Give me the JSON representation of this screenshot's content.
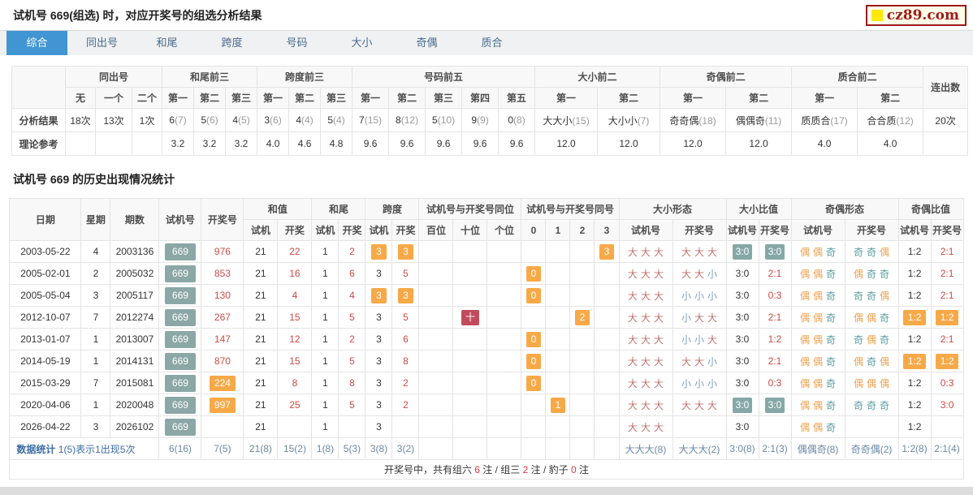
{
  "page_title": "试机号 669(组选) 时，对应开奖号的组选分析结果",
  "logo": {
    "text": "cz89.com"
  },
  "tabs": [
    {
      "label": "综合",
      "active": true
    },
    {
      "label": "同出号"
    },
    {
      "label": "和尾"
    },
    {
      "label": "跨度"
    },
    {
      "label": "号码"
    },
    {
      "label": "大小"
    },
    {
      "label": "奇偶"
    },
    {
      "label": "质合"
    }
  ],
  "analysis": {
    "groups": [
      {
        "label": "同出号",
        "cols": [
          "无",
          "一个",
          "二个"
        ]
      },
      {
        "label": "和尾前三",
        "cols": [
          "第一",
          "第二",
          "第三"
        ]
      },
      {
        "label": "跨度前三",
        "cols": [
          "第一",
          "第二",
          "第三"
        ]
      },
      {
        "label": "号码前五",
        "cols": [
          "第一",
          "第二",
          "第三",
          "第四",
          "第五"
        ]
      },
      {
        "label": "大小前二",
        "cols": [
          "第一",
          "第二"
        ]
      },
      {
        "label": "奇偶前二",
        "cols": [
          "第一",
          "第二"
        ]
      },
      {
        "label": "质合前二",
        "cols": [
          "第一",
          "第二"
        ]
      }
    ],
    "last_col": "连出数",
    "rows": [
      {
        "label": "分析结果",
        "values": [
          "18次",
          "13次",
          "1次",
          "6(7)",
          "5(6)",
          "4(5)",
          "3(6)",
          "4(4)",
          "5(4)",
          "7(15)",
          "8(12)",
          "5(10)",
          "9(9)",
          "0(8)",
          "大大小(15)",
          "大小小(7)",
          "奇奇偶(18)",
          "偶偶奇(11)",
          "质质合(17)",
          "合合质(12)",
          "20次"
        ]
      },
      {
        "label": "理论参考",
        "values": [
          "",
          "",
          "",
          "3.2",
          "3.2",
          "3.2",
          "4.0",
          "4.6",
          "4.8",
          "9.6",
          "9.6",
          "9.6",
          "9.6",
          "9.6",
          "12.0",
          "12.0",
          "12.0",
          "12.0",
          "4.0",
          "4.0",
          ""
        ]
      }
    ]
  },
  "history": {
    "title": "试机号 669 的历史出现情况统计",
    "header": {
      "simple": [
        "日期",
        "星期",
        "期数",
        "试机号",
        "开奖号"
      ],
      "groups": [
        {
          "label": "和值",
          "cols": [
            "试机",
            "开奖"
          ]
        },
        {
          "label": "和尾",
          "cols": [
            "试机",
            "开奖"
          ]
        },
        {
          "label": "跨度",
          "cols": [
            "试机",
            "开奖"
          ]
        },
        {
          "label": "试机号与开奖号同位",
          "cols": [
            "百位",
            "十位",
            "个位"
          ]
        },
        {
          "label": "试机号与开奖号同号",
          "cols": [
            "0",
            "1",
            "2",
            "3"
          ]
        },
        {
          "label": "大小形态",
          "cols": [
            "试机号",
            "开奖号"
          ]
        },
        {
          "label": "大小比值",
          "cols": [
            "试机号",
            "开奖号"
          ]
        },
        {
          "label": "奇偶形态",
          "cols": [
            "试机号",
            "开奖号"
          ]
        },
        {
          "label": "奇偶比值",
          "cols": [
            "试机号",
            "开奖号"
          ]
        }
      ]
    },
    "rows": [
      [
        [
          "2003-05-22",
          ""
        ],
        [
          "4",
          ""
        ],
        [
          "2003136",
          ""
        ],
        [
          "669",
          "b669"
        ],
        [
          "976",
          "red"
        ],
        [
          "21",
          ""
        ],
        [
          "22",
          "red"
        ],
        [
          "1",
          ""
        ],
        [
          "2",
          "red"
        ],
        [
          "3",
          "bo"
        ],
        [
          "3",
          "bo"
        ],
        [
          "",
          ""
        ],
        [
          "",
          ""
        ],
        [
          "",
          ""
        ],
        [
          "",
          ""
        ],
        [
          "",
          ""
        ],
        [
          "",
          ""
        ],
        [
          "3",
          "bo"
        ],
        [
          "大大大",
          "pat"
        ],
        [
          "大大大",
          "pat"
        ],
        [
          "3:0",
          "bt"
        ],
        [
          "3:0",
          "bt"
        ],
        [
          "偶偶奇",
          "pat"
        ],
        [
          "奇奇偶",
          "pat"
        ],
        [
          "1:2",
          ""
        ],
        [
          "2:1",
          "red"
        ]
      ],
      [
        [
          "2005-02-01",
          ""
        ],
        [
          "2",
          ""
        ],
        [
          "2005032",
          ""
        ],
        [
          "669",
          "b669"
        ],
        [
          "853",
          "red"
        ],
        [
          "21",
          ""
        ],
        [
          "16",
          "red"
        ],
        [
          "1",
          ""
        ],
        [
          "6",
          "red"
        ],
        [
          "3",
          ""
        ],
        [
          "5",
          "red"
        ],
        [
          "",
          ""
        ],
        [
          "",
          ""
        ],
        [
          "",
          ""
        ],
        [
          "0",
          "bo"
        ],
        [
          "",
          ""
        ],
        [
          "",
          ""
        ],
        [
          "",
          ""
        ],
        [
          "大大大",
          "pat"
        ],
        [
          "大大小",
          "pat"
        ],
        [
          "3:0",
          ""
        ],
        [
          "2:1",
          "red"
        ],
        [
          "偶偶奇",
          "pat"
        ],
        [
          "偶奇奇",
          "pat"
        ],
        [
          "1:2",
          ""
        ],
        [
          "2:1",
          "red"
        ]
      ],
      [
        [
          "2005-05-04",
          ""
        ],
        [
          "3",
          ""
        ],
        [
          "2005117",
          ""
        ],
        [
          "669",
          "b669"
        ],
        [
          "130",
          "red"
        ],
        [
          "21",
          ""
        ],
        [
          "4",
          "red"
        ],
        [
          "1",
          ""
        ],
        [
          "4",
          "red"
        ],
        [
          "3",
          "bo"
        ],
        [
          "3",
          "bo"
        ],
        [
          "",
          ""
        ],
        [
          "",
          ""
        ],
        [
          "",
          ""
        ],
        [
          "0",
          "bo"
        ],
        [
          "",
          ""
        ],
        [
          "",
          ""
        ],
        [
          "",
          ""
        ],
        [
          "大大大",
          "pat"
        ],
        [
          "小小小",
          "pat"
        ],
        [
          "3:0",
          ""
        ],
        [
          "0:3",
          "red"
        ],
        [
          "偶偶奇",
          "pat"
        ],
        [
          "奇奇偶",
          "pat"
        ],
        [
          "1:2",
          ""
        ],
        [
          "2:1",
          "red"
        ]
      ],
      [
        [
          "2012-10-07",
          ""
        ],
        [
          "7",
          ""
        ],
        [
          "2012274",
          ""
        ],
        [
          "669",
          "b669"
        ],
        [
          "267",
          "red"
        ],
        [
          "21",
          ""
        ],
        [
          "15",
          "red"
        ],
        [
          "1",
          ""
        ],
        [
          "5",
          "red"
        ],
        [
          "3",
          ""
        ],
        [
          "5",
          "red"
        ],
        [
          "",
          ""
        ],
        [
          "十",
          "bc"
        ],
        [
          "",
          ""
        ],
        [
          "",
          ""
        ],
        [
          "",
          ""
        ],
        [
          "2",
          "bo"
        ],
        [
          "",
          ""
        ],
        [
          "大大大",
          "pat"
        ],
        [
          "小大大",
          "pat"
        ],
        [
          "3:0",
          ""
        ],
        [
          "2:1",
          "red"
        ],
        [
          "偶偶奇",
          "pat"
        ],
        [
          "偶偶奇",
          "pat"
        ],
        [
          "1:2",
          "bo"
        ],
        [
          "1:2",
          "bo"
        ]
      ],
      [
        [
          "2013-01-07",
          ""
        ],
        [
          "1",
          ""
        ],
        [
          "2013007",
          ""
        ],
        [
          "669",
          "b669"
        ],
        [
          "147",
          "red"
        ],
        [
          "21",
          ""
        ],
        [
          "12",
          "red"
        ],
        [
          "1",
          ""
        ],
        [
          "2",
          "red"
        ],
        [
          "3",
          ""
        ],
        [
          "6",
          "red"
        ],
        [
          "",
          ""
        ],
        [
          "",
          ""
        ],
        [
          "",
          ""
        ],
        [
          "0",
          "bo"
        ],
        [
          "",
          ""
        ],
        [
          "",
          ""
        ],
        [
          "",
          ""
        ],
        [
          "大大大",
          "pat"
        ],
        [
          "小小大",
          "pat"
        ],
        [
          "3:0",
          ""
        ],
        [
          "1:2",
          "red"
        ],
        [
          "偶偶奇",
          "pat"
        ],
        [
          "奇偶奇",
          "pat"
        ],
        [
          "1:2",
          ""
        ],
        [
          "2:1",
          "red"
        ]
      ],
      [
        [
          "2014-05-19",
          ""
        ],
        [
          "1",
          ""
        ],
        [
          "2014131",
          ""
        ],
        [
          "669",
          "b669"
        ],
        [
          "870",
          "red"
        ],
        [
          "21",
          ""
        ],
        [
          "15",
          "red"
        ],
        [
          "1",
          ""
        ],
        [
          "5",
          "red"
        ],
        [
          "3",
          ""
        ],
        [
          "8",
          "red"
        ],
        [
          "",
          ""
        ],
        [
          "",
          ""
        ],
        [
          "",
          ""
        ],
        [
          "0",
          "bo"
        ],
        [
          "",
          ""
        ],
        [
          "",
          ""
        ],
        [
          "",
          ""
        ],
        [
          "大大大",
          "pat"
        ],
        [
          "大大小",
          "pat"
        ],
        [
          "3:0",
          ""
        ],
        [
          "2:1",
          "red"
        ],
        [
          "偶偶奇",
          "pat"
        ],
        [
          "偶奇偶",
          "pat"
        ],
        [
          "1:2",
          "bo"
        ],
        [
          "1:2",
          "bo"
        ]
      ],
      [
        [
          "2015-03-29",
          ""
        ],
        [
          "7",
          ""
        ],
        [
          "2015081",
          ""
        ],
        [
          "669",
          "b669"
        ],
        [
          "224",
          "bo"
        ],
        [
          "21",
          ""
        ],
        [
          "8",
          "red"
        ],
        [
          "1",
          ""
        ],
        [
          "8",
          "red"
        ],
        [
          "3",
          ""
        ],
        [
          "2",
          "red"
        ],
        [
          "",
          ""
        ],
        [
          "",
          ""
        ],
        [
          "",
          ""
        ],
        [
          "0",
          "bo"
        ],
        [
          "",
          ""
        ],
        [
          "",
          ""
        ],
        [
          "",
          ""
        ],
        [
          "大大大",
          "pat"
        ],
        [
          "小小小",
          "pat"
        ],
        [
          "3:0",
          ""
        ],
        [
          "0:3",
          "red"
        ],
        [
          "偶偶奇",
          "pat"
        ],
        [
          "偶偶偶",
          "pat"
        ],
        [
          "1:2",
          ""
        ],
        [
          "0:3",
          "red"
        ]
      ],
      [
        [
          "2020-04-06",
          ""
        ],
        [
          "1",
          ""
        ],
        [
          "2020048",
          ""
        ],
        [
          "669",
          "b669"
        ],
        [
          "997",
          "bo"
        ],
        [
          "21",
          ""
        ],
        [
          "25",
          "red"
        ],
        [
          "1",
          ""
        ],
        [
          "5",
          "red"
        ],
        [
          "3",
          ""
        ],
        [
          "2",
          "red"
        ],
        [
          "",
          ""
        ],
        [
          "",
          ""
        ],
        [
          "",
          ""
        ],
        [
          "",
          ""
        ],
        [
          "1",
          "bo"
        ],
        [
          "",
          ""
        ],
        [
          "",
          ""
        ],
        [
          "大大大",
          "pat"
        ],
        [
          "大大大",
          "pat"
        ],
        [
          "3:0",
          "bt"
        ],
        [
          "3:0",
          "bt"
        ],
        [
          "偶偶奇",
          "pat"
        ],
        [
          "奇奇奇",
          "pat"
        ],
        [
          "1:2",
          ""
        ],
        [
          "3:0",
          "red"
        ]
      ],
      [
        [
          "2026-04-22",
          ""
        ],
        [
          "3",
          ""
        ],
        [
          "2026102",
          ""
        ],
        [
          "669",
          "b669"
        ],
        [
          "",
          ""
        ],
        [
          "21",
          ""
        ],
        [
          "",
          ""
        ],
        [
          "1",
          ""
        ],
        [
          "",
          ""
        ],
        [
          "3",
          ""
        ],
        [
          "",
          ""
        ],
        [
          "",
          ""
        ],
        [
          "",
          ""
        ],
        [
          "",
          ""
        ],
        [
          "",
          ""
        ],
        [
          "",
          ""
        ],
        [
          "",
          ""
        ],
        [
          "",
          ""
        ],
        [
          "大大大",
          "pat"
        ],
        [
          "",
          ""
        ],
        [
          "3:0",
          ""
        ],
        [
          "",
          ""
        ],
        [
          "偶偶奇",
          "pat"
        ],
        [
          "",
          ""
        ],
        [
          "1:2",
          ""
        ],
        [
          "",
          ""
        ]
      ]
    ],
    "stats": {
      "label": "数据统计",
      "note": "1(5)表示1出现5次",
      "values": [
        "6(16)",
        "7(5)",
        "21(8)",
        "15(2)",
        "1(8)",
        "5(3)",
        "3(8)",
        "3(2)",
        "",
        "",
        "",
        "",
        "",
        "",
        "",
        "大大大(8)",
        "大大大(2)",
        "3:0(8)",
        "2:1(3)",
        "偶偶奇(8)",
        "奇奇偶(2)",
        "1:2(8)",
        "2:1(4)"
      ]
    },
    "footer_segments": [
      {
        "text": "开奖号中，共有组六 "
      },
      {
        "text": "6",
        "red": true
      },
      {
        "text": " 注 / 组三 "
      },
      {
        "text": "2",
        "red": true
      },
      {
        "text": " 注 / 豹子 "
      },
      {
        "text": "0",
        "red": true
      },
      {
        "text": " 注"
      }
    ]
  },
  "colors": {
    "accent_blue": "#4195d3",
    "red_value": "#cf4a45",
    "orange_badge": "#f7a948",
    "teal_badge": "#85a8a6",
    "crimson_badge": "#c14b5d",
    "trial_badge": "#8ba7a6",
    "big_char": "#c0716f",
    "small_char": "#7e9fc5",
    "even_char": "#f0a04e",
    "odd_char": "#579b9b",
    "stats_blue": "#3e6da5",
    "footer_num_red": "#e4393c",
    "logo_red": "#9b1b1b",
    "logo_yellow": "#ffe900"
  }
}
